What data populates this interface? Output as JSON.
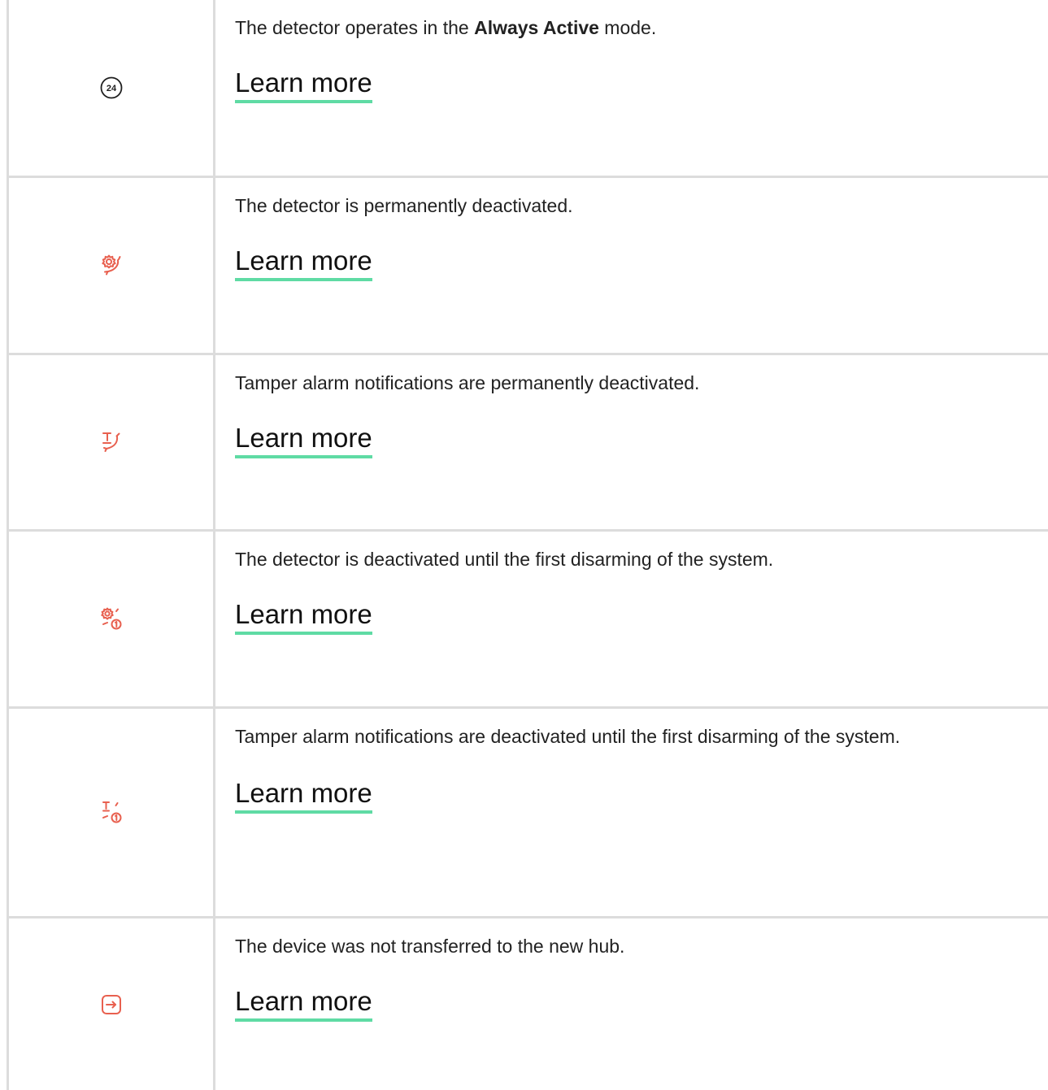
{
  "colors": {
    "accent_underline": "#5fdba4",
    "icon_red": "#e8604f",
    "icon_dark": "#1f1f1f",
    "border": "#dcdcdc"
  },
  "rows": [
    {
      "icon": "always-active-24-icon",
      "desc_before": "The detector operates in the ",
      "desc_bold": "Always Active",
      "desc_after": " mode.",
      "link": "Learn more"
    },
    {
      "icon": "gear-deactivated-icon",
      "desc": "The detector is permanently deactivated.",
      "link": "Learn more"
    },
    {
      "icon": "tamper-deactivated-icon",
      "desc": "Tamper alarm notifications are permanently deactivated.",
      "link": "Learn more"
    },
    {
      "icon": "gear-deactivated-once-icon",
      "desc": "The detector is deactivated until the first disarming of the system.",
      "link": "Learn more"
    },
    {
      "icon": "tamper-deactivated-once-icon",
      "desc": "Tamper alarm notifications are deactivated until the first disarming of the system.",
      "link": "Learn more"
    },
    {
      "icon": "transfer-arrow-icon",
      "desc": "The device was not transferred to the new hub.",
      "link": "Learn more"
    }
  ],
  "icon_labels": {
    "always_active": "24"
  }
}
